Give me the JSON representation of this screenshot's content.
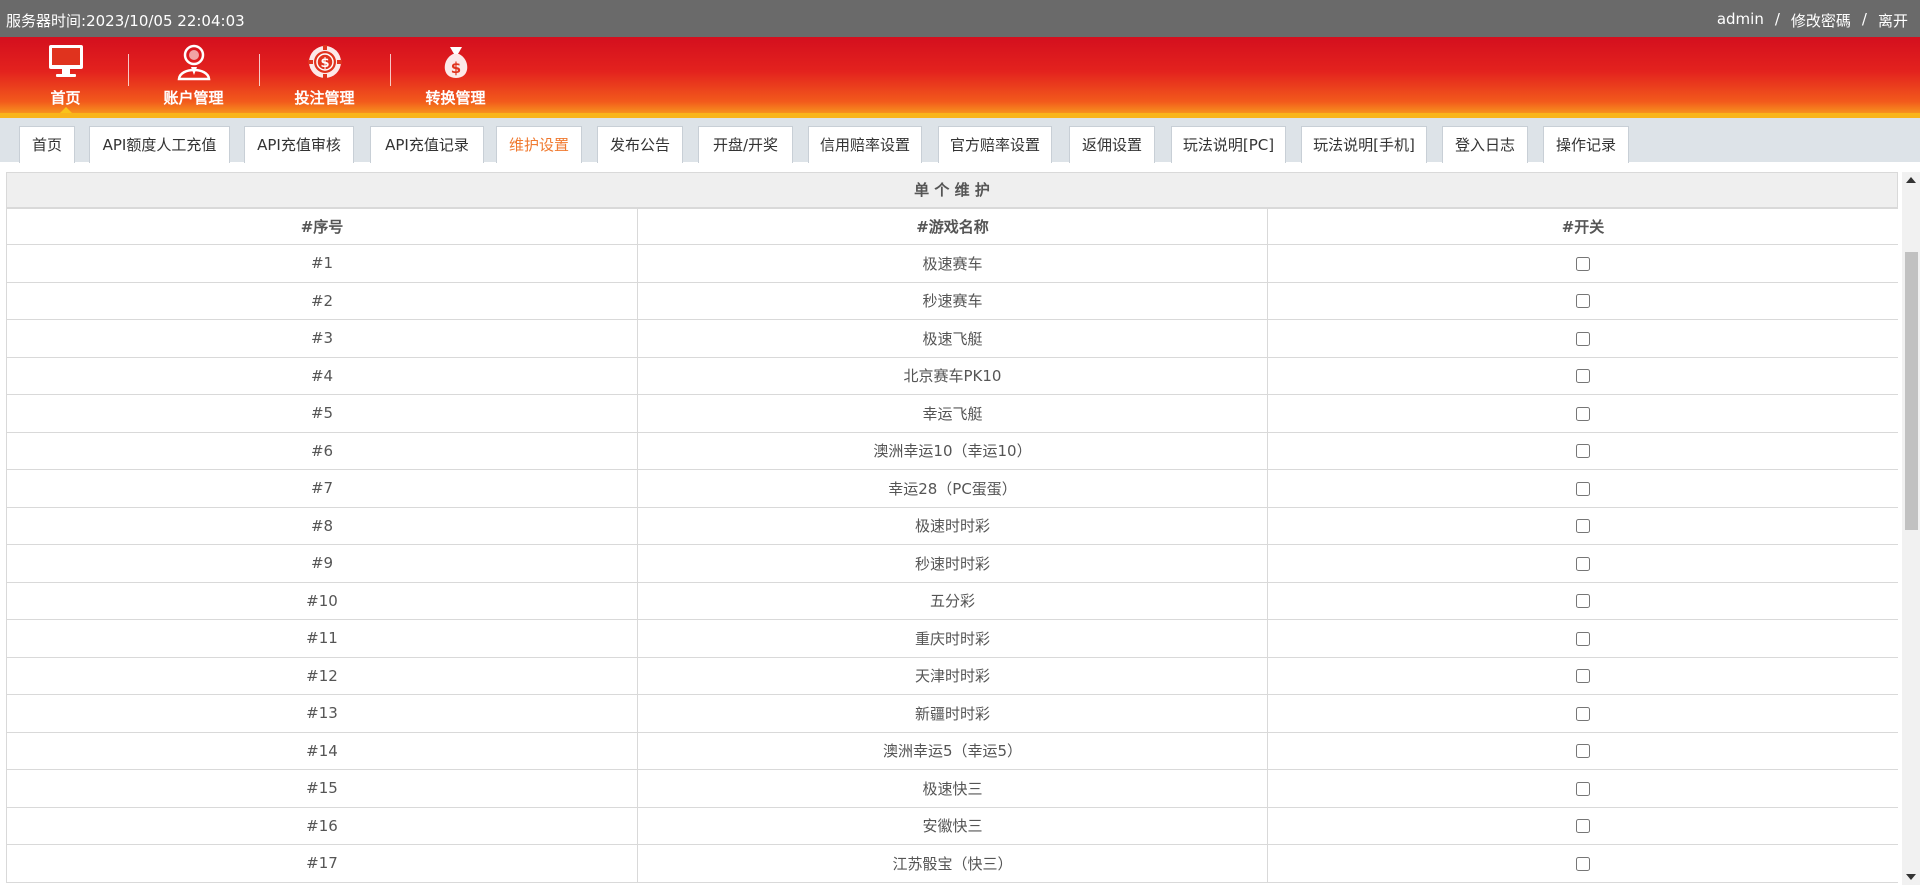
{
  "topbar": {
    "server_time_label": "服务器时间:",
    "server_time_value": "2023/10/05 22:04:03",
    "username": "admin",
    "separator": "/",
    "change_password": "修改密碼",
    "logout": "离开"
  },
  "nav": {
    "items": [
      {
        "label": "首页",
        "icon": "monitor-icon",
        "active": true
      },
      {
        "label": "账户管理",
        "icon": "user-icon"
      },
      {
        "label": "投注管理",
        "icon": "chip-icon"
      },
      {
        "label": "转换管理",
        "icon": "money-bag-icon"
      }
    ]
  },
  "tabs": [
    {
      "label": "首页"
    },
    {
      "label": "API额度人工充值"
    },
    {
      "label": "API充值审核"
    },
    {
      "label": "API充值记录"
    },
    {
      "label": "维护设置",
      "active": true
    },
    {
      "label": "发布公告"
    },
    {
      "label": "开盘/开奖"
    },
    {
      "label": "信用赔率设置"
    },
    {
      "label": "官方赔率设置"
    },
    {
      "label": "返佣设置"
    },
    {
      "label": "玩法说明[PC]"
    },
    {
      "label": "玩法说明[手机]"
    },
    {
      "label": "登入日志"
    },
    {
      "label": "操作记录"
    }
  ],
  "table": {
    "title": "单 个 维 护",
    "headers": [
      "#序号",
      "#游戏名称",
      "#开关"
    ],
    "rows": [
      {
        "no": "#1",
        "name": "极速赛车",
        "enabled": false
      },
      {
        "no": "#2",
        "name": "秒速赛车",
        "enabled": false
      },
      {
        "no": "#3",
        "name": "极速飞艇",
        "enabled": false
      },
      {
        "no": "#4",
        "name": "北京赛车PK10",
        "enabled": false
      },
      {
        "no": "#5",
        "name": "幸运飞艇",
        "enabled": false
      },
      {
        "no": "#6",
        "name": "澳洲幸运10（幸运10）",
        "enabled": false
      },
      {
        "no": "#7",
        "name": "幸运28（PC蛋蛋）",
        "enabled": false
      },
      {
        "no": "#8",
        "name": "极速时时彩",
        "enabled": false
      },
      {
        "no": "#9",
        "name": "秒速时时彩",
        "enabled": false
      },
      {
        "no": "#10",
        "name": "五分彩",
        "enabled": false
      },
      {
        "no": "#11",
        "name": "重庆时时彩",
        "enabled": false
      },
      {
        "no": "#12",
        "name": "天津时时彩",
        "enabled": false
      },
      {
        "no": "#13",
        "name": "新疆时时彩",
        "enabled": false
      },
      {
        "no": "#14",
        "name": "澳洲幸运5（幸运5）",
        "enabled": false
      },
      {
        "no": "#15",
        "name": "极速快三",
        "enabled": false
      },
      {
        "no": "#16",
        "name": "安徽快三",
        "enabled": false
      },
      {
        "no": "#17",
        "name": "江苏骰宝（快三）",
        "enabled": false
      }
    ]
  },
  "colors": {
    "header_red": "#d40f1e",
    "header_orange": "#f7911e",
    "accent_yellow": "#f9b51a",
    "active_tab": "#f07a30",
    "topbar_gray": "#6a6a6a"
  }
}
